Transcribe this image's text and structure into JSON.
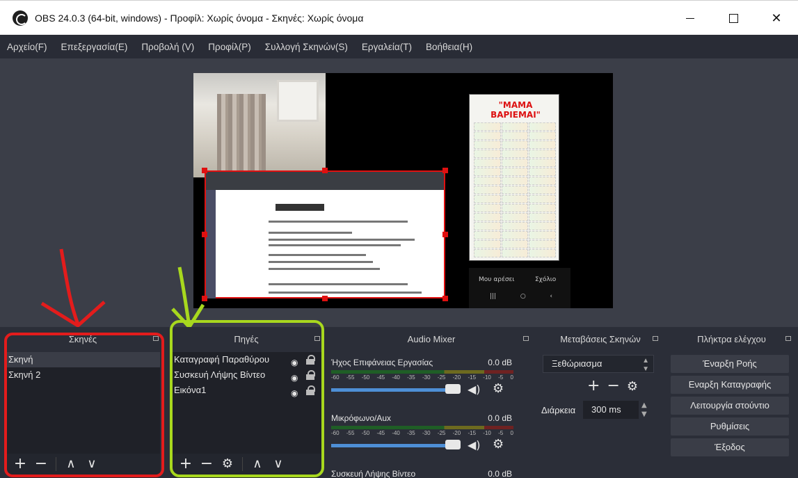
{
  "window": {
    "title": "OBS 24.0.3 (64-bit, windows) - Προφίλ: Χωρίς όνομα - Σκηνές: Χωρίς όνομα",
    "buttons": {
      "minimize": "",
      "maximize": "",
      "close": "✕"
    }
  },
  "menu": [
    "Αρχείο(F)",
    "Επεξεργασία(E)",
    "Προβολή (V)",
    "Προφίλ(P)",
    "Συλλογή Σκηνών(S)",
    "Εργαλεία(T)",
    "Βοήθεια(H)"
  ],
  "preview": {
    "doc_title": "\"ΜΑΜΑ ΒΑΡΙΕΜΑΙ\"",
    "phone_labels": [
      "Μου αρέσει",
      "Σχόλιο"
    ]
  },
  "scenes": {
    "title": "Σκηνές",
    "items": [
      "Σκηνή",
      "Σκηνή 2"
    ],
    "selected_index": 0
  },
  "sources": {
    "title": "Πηγές",
    "items": [
      "Καταγραφή Παραθύρου",
      "Συσκευή Λήψης Βίντεο",
      "Εικόνα1"
    ]
  },
  "mixer": {
    "title": "Audio Mixer",
    "tick_labels": [
      "-60",
      "-55",
      "-50",
      "-45",
      "-40",
      "-35",
      "-30",
      "-25",
      "-20",
      "-15",
      "-10",
      "-5",
      "0"
    ],
    "channels": [
      {
        "name": "Ήχος Επιφάνειας Εργασίας",
        "db": "0.0 dB"
      },
      {
        "name": "Μικρόφωνο/Aux",
        "db": "0.0 dB"
      },
      {
        "name": "Συσκευή Λήψης Βίντεο",
        "db": "0.0 dB"
      }
    ]
  },
  "transitions": {
    "title": "Μεταβάσεις Σκηνών",
    "selected": "Ξεθώριασμα",
    "duration_label": "Διάρκεια",
    "duration_value": "300 ms"
  },
  "controls": {
    "title": "Πλήκτρα ελέγχου",
    "buttons": [
      "Έναρξη Ροής",
      "Εναρξη Καταγραφής",
      "Λειτουργία στούντιο",
      "Ρυθμίσεις",
      "Έξοδος"
    ]
  },
  "colors": {
    "annotation_red": "#e31c1c",
    "annotation_green": "#a8d81e",
    "selection_red": "#e01010"
  }
}
